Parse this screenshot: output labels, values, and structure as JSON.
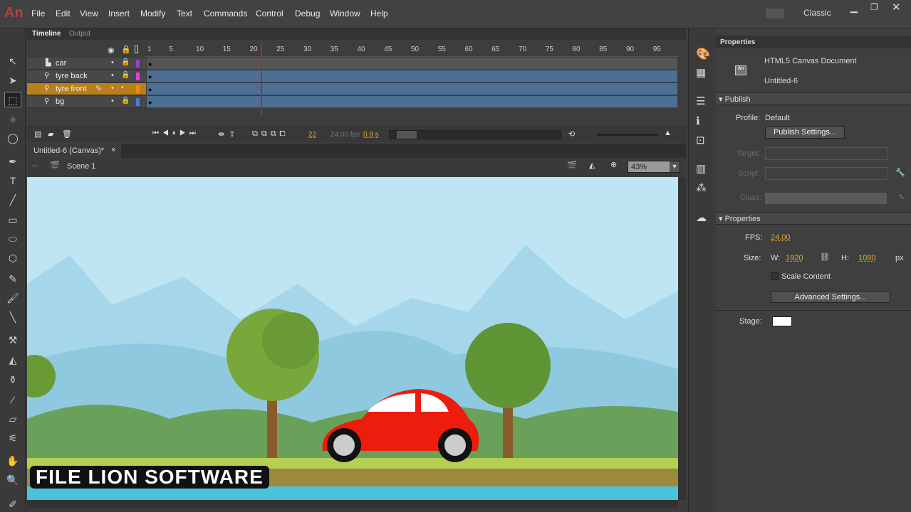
{
  "app": {
    "logo": "An",
    "menu": [
      "File",
      "Edit",
      "View",
      "Insert",
      "Modify",
      "Text",
      "Commands",
      "Control",
      "Debug",
      "Window",
      "Help"
    ],
    "workspace": "Classic"
  },
  "timeline": {
    "tabs": [
      "Timeline",
      "Output"
    ],
    "ticks": [
      "1",
      "5",
      "10",
      "15",
      "20",
      "25",
      "30",
      "35",
      "40",
      "45",
      "50",
      "55",
      "60",
      "65",
      "70",
      "75",
      "80",
      "85",
      "90",
      "95"
    ],
    "layers": [
      {
        "name": "car",
        "color": "#9b3fc4"
      },
      {
        "name": "tyre back",
        "color": "#e23fe0"
      },
      {
        "name": "tyre front",
        "color": "#f08a10"
      },
      {
        "name": "bg",
        "color": "#3f7fe0"
      }
    ],
    "current_frame": "22",
    "fps": "24.00 fps",
    "elapsed": "0.9 s"
  },
  "document": {
    "tab": "Untitled-6 (Canvas)*",
    "scene": "Scene 1",
    "zoom": "43%"
  },
  "properties": {
    "tab": "Properties",
    "doc_type": "HTML5 Canvas Document",
    "doc_name": "Untitled-6",
    "publish_header": "Publish",
    "profile_label": "Profile:",
    "profile": "Default",
    "publish_settings": "Publish Settings...",
    "target_label": "Target:",
    "script_label": "Script:",
    "class_label": "Class:",
    "props_header": "Properties",
    "fps_label": "FPS:",
    "fps": "24.00",
    "size_label": "Size:",
    "w_label": "W:",
    "w": "1920",
    "h_label": "H:",
    "h": "1080",
    "unit": "px",
    "scale_content": "Scale Content",
    "advanced": "Advanced Settings...",
    "stage_label": "Stage:",
    "stage_color": "#ffffff"
  },
  "watermark": "FILE LION SOFTWARE"
}
